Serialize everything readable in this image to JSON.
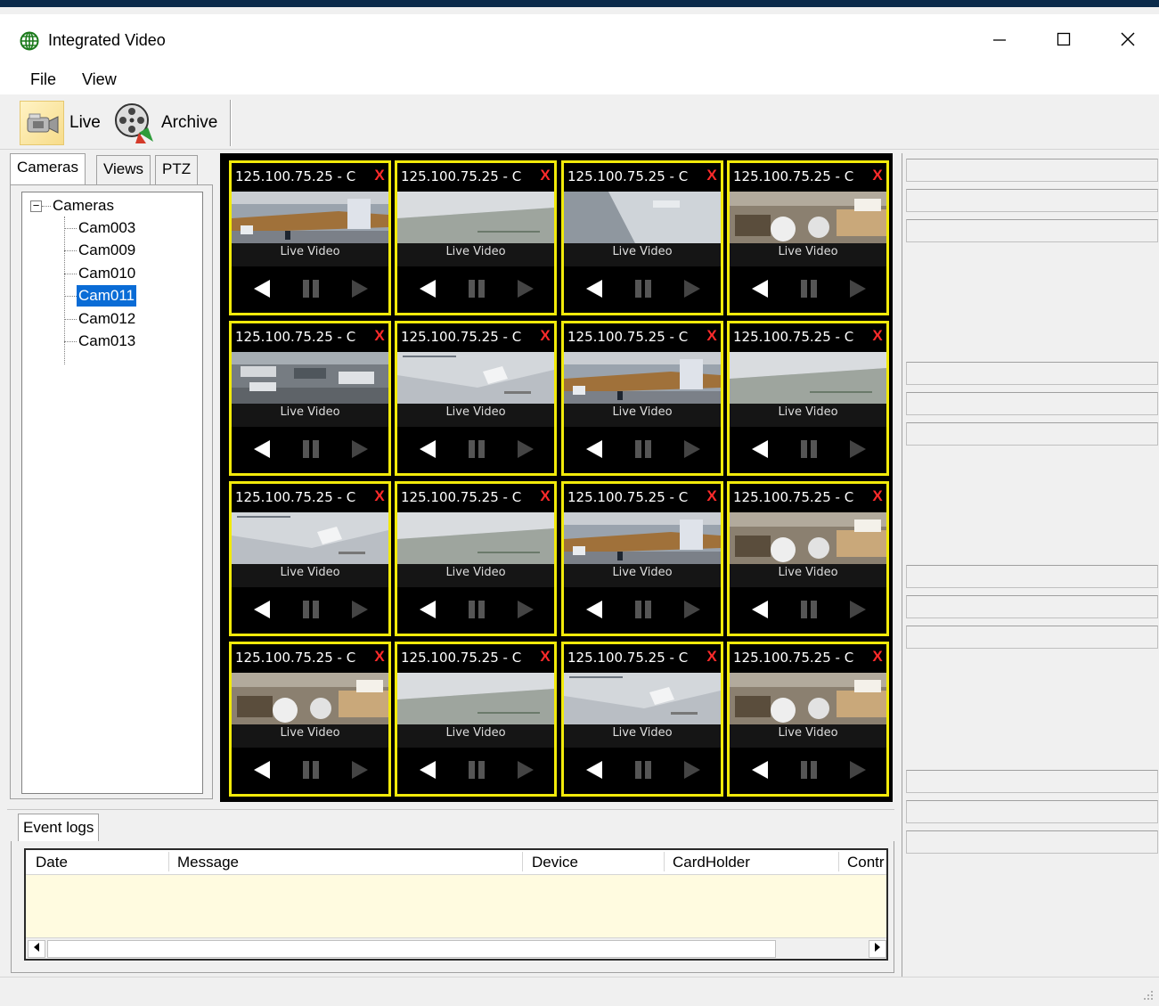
{
  "window": {
    "title": "Integrated Video"
  },
  "menu": {
    "items": [
      "File",
      "View"
    ]
  },
  "toolbar": {
    "live_label": "Live",
    "archive_label": "Archive"
  },
  "left_tabs": [
    "Cameras",
    "Views",
    "PTZ"
  ],
  "tree": {
    "root": "Cameras",
    "items": [
      "Cam003",
      "Cam009",
      "Cam010",
      "Cam011",
      "Cam012",
      "Cam013"
    ],
    "selected": "Cam011"
  },
  "video_grid": {
    "cell_title": "125.100.75.25 - C",
    "close_glyph": "X",
    "live_label": "Live Video",
    "scenes": [
      "counter",
      "wall",
      "hall",
      "storage",
      "parking",
      "ceiling",
      "counter",
      "wall",
      "ceiling",
      "wall",
      "counter",
      "storage",
      "storage",
      "wall",
      "ceiling",
      "storage"
    ]
  },
  "event_logs": {
    "tab_label": "Event logs",
    "columns": [
      "Date",
      "Message",
      "Device",
      "CardHolder",
      "Contr"
    ],
    "rows": []
  },
  "colors": {
    "cell_border": "#f2ea0a",
    "video_bg": "#000000",
    "selection": "#0a6cd6",
    "log_bg": "#fffbe0",
    "close_x": "#ff2b2b"
  },
  "icons": [
    "app-globe-icon",
    "minimize-icon",
    "maximize-icon",
    "close-icon",
    "camcorder-icon",
    "film-reel-icon",
    "rewind-icon",
    "pause-icon",
    "play-icon",
    "scroll-left-icon",
    "scroll-right-icon",
    "resize-grip-icon"
  ]
}
